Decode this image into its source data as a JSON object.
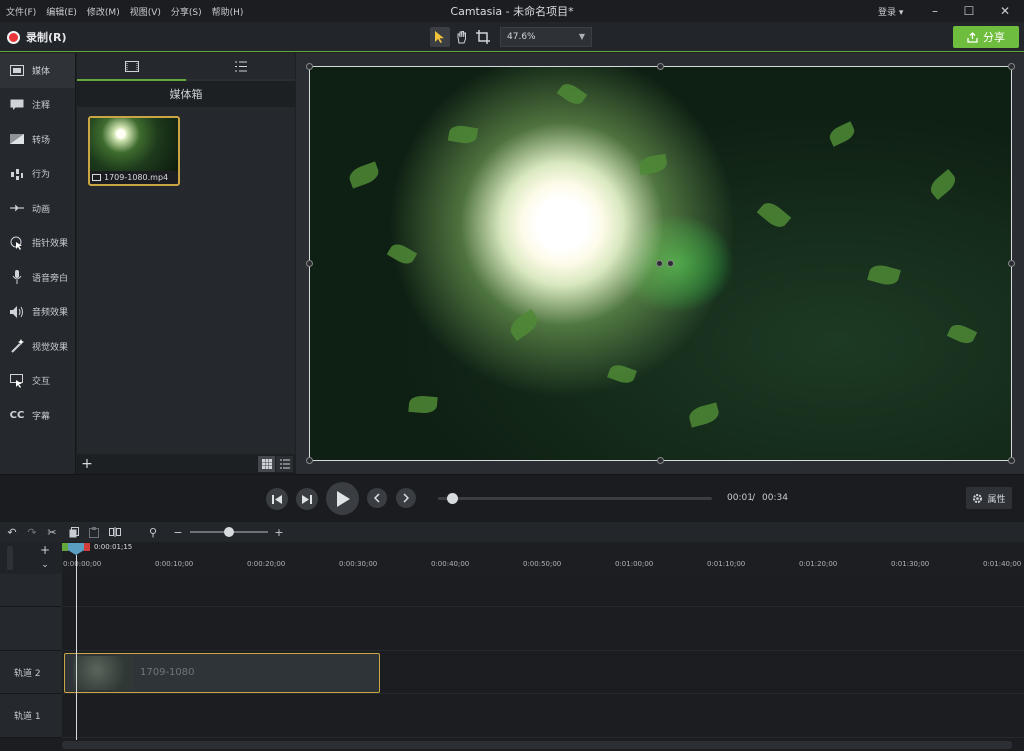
{
  "menu": [
    "文件(F)",
    "编辑(E)",
    "修改(M)",
    "视图(V)",
    "分享(S)",
    "帮助(H)"
  ],
  "app_title": "Camtasia - 未命名项目*",
  "login": "登录 ▾",
  "record_label": "录制(R)",
  "zoom_level": "47.6%",
  "share_label": "分享",
  "sidebar": [
    {
      "label": "媒体",
      "icon": "film-icon"
    },
    {
      "label": "注释",
      "icon": "annotation-icon"
    },
    {
      "label": "转场",
      "icon": "transition-icon"
    },
    {
      "label": "行为",
      "icon": "behavior-icon"
    },
    {
      "label": "动画",
      "icon": "animation-icon"
    },
    {
      "label": "指针效果",
      "icon": "cursor-effect-icon"
    },
    {
      "label": "语音旁白",
      "icon": "microphone-icon"
    },
    {
      "label": "音频效果",
      "icon": "audio-effect-icon"
    },
    {
      "label": "视觉效果",
      "icon": "visual-effect-icon"
    },
    {
      "label": "交互",
      "icon": "interactive-icon"
    },
    {
      "label": "字幕",
      "icon": "captions-icon"
    }
  ],
  "mediabin": {
    "title": "媒体箱",
    "item_name": "1709-1080.mp4"
  },
  "playback": {
    "current_time": "00:01",
    "separator": "/",
    "total_time": "00:34",
    "progress": 0.03,
    "properties_label": "属性"
  },
  "timeline": {
    "playhead_time": "0:00:01;15",
    "ticks": [
      "0:00:00;00",
      "0:00:10;00",
      "0:00:20;00",
      "0:00:30;00",
      "0:00:40;00",
      "0:00:50;00",
      "0:01:00;00",
      "0:01:10;00",
      "0:01:20;00",
      "0:01:30;00",
      "0:01:40;00"
    ],
    "tracks": [
      "轨道 2",
      "轨道 1"
    ],
    "clip_label": "1709-1080"
  }
}
